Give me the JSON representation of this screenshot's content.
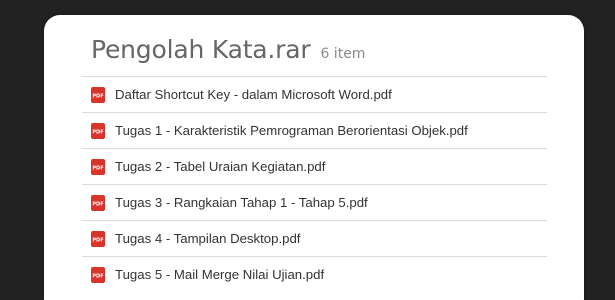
{
  "archive": {
    "title": "Pengolah Kata.rar",
    "count": "6 item"
  },
  "files": [
    {
      "name": "Daftar Shortcut Key - dalam Microsoft Word.pdf",
      "icon": "pdf-icon",
      "icon_text": "PDF"
    },
    {
      "name": "Tugas 1 - Karakteristik Pemrograman Berorientasi Objek.pdf",
      "icon": "pdf-icon",
      "icon_text": "PDF"
    },
    {
      "name": "Tugas 2 - Tabel Uraian Kegiatan.pdf",
      "icon": "pdf-icon",
      "icon_text": "PDF"
    },
    {
      "name": "Tugas 3 - Rangkaian Tahap 1 - Tahap 5.pdf",
      "icon": "pdf-icon",
      "icon_text": "PDF"
    },
    {
      "name": "Tugas 4 - Tampilan Desktop.pdf",
      "icon": "pdf-icon",
      "icon_text": "PDF"
    },
    {
      "name": "Tugas 5 - Mail Merge Nilai Ujian.pdf",
      "icon": "pdf-icon",
      "icon_text": "PDF"
    }
  ],
  "colors": {
    "background": "#222222",
    "card": "#ffffff",
    "pdf_icon": "#d9342b"
  }
}
